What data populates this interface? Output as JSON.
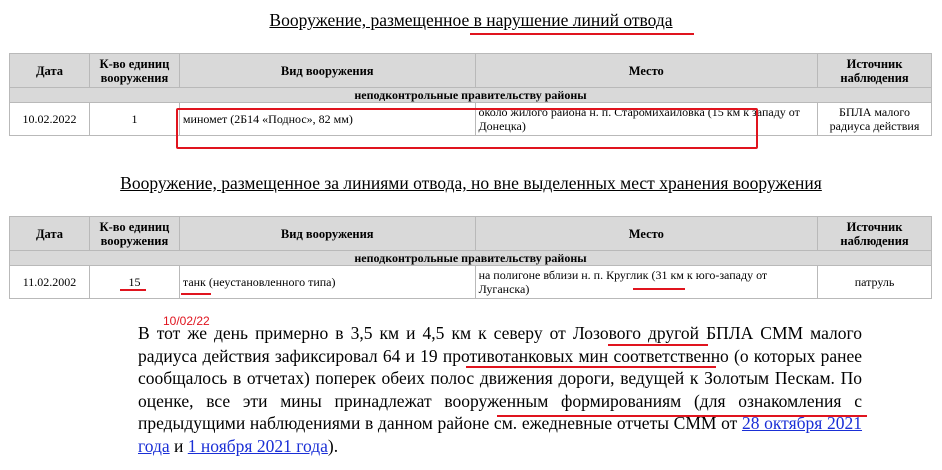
{
  "section1": {
    "title": "Вооружение, размещенное в нарушение линий отвода",
    "headers": [
      "Дата",
      "К-во единиц вооружения",
      "Вид вооружения",
      "Место",
      "Источник наблюдения"
    ],
    "group": "неподконтрольные правительству районы",
    "row": {
      "date": "10.02.2022",
      "count": "1",
      "weapon": "миномет (2Б14 «Поднос», 82 мм)",
      "place": "около жилого района н. п. Старомихайловка (15 км к западу от Донецка)",
      "source": "БПЛА малого радиуса действия"
    }
  },
  "section2": {
    "title": "Вооружение, размещенное за линиями отвода, но вне выделенных мест хранения вооружения",
    "headers": [
      "Дата",
      "К-во единиц вооружения",
      "Вид вооружения",
      "Место",
      "Источник наблюдения"
    ],
    "group": "неподконтрольные правительству районы",
    "row": {
      "date": "11.02.2002",
      "count": "15",
      "weapon": "танк (неустановленного типа)",
      "place": "на полигоне вблизи н. п. Круглик (31 км к юго-западу от Луганска)",
      "source": "патруль"
    }
  },
  "annotation": "10/02/22",
  "paragraph": {
    "text_before": "В тот же день примерно в 3,5 км и 4,5 км к северу от Лозового другой БПЛА СММ малого радиуса действия зафиксировал 64 и 19 противотанковых мин соответственно (о которых ранее сообщалось в отчетах) поперек обеих полос движения дороги, ведущей к Золотым Пескам. По оценке, все эти мины принадлежат вооруженным формированиям (для ознакомления с предыдущими наблюдениями в данном районе см. ежедневные отчеты СММ от ",
    "link1": "28 октября 2021 года",
    "text_middle": " и ",
    "link2": "1 ноября 2021 года",
    "text_after": ")."
  },
  "colors": {
    "markup_red": "#e0141e",
    "link_blue": "#1a2fd6",
    "header_gray": "#d9d9d9"
  }
}
